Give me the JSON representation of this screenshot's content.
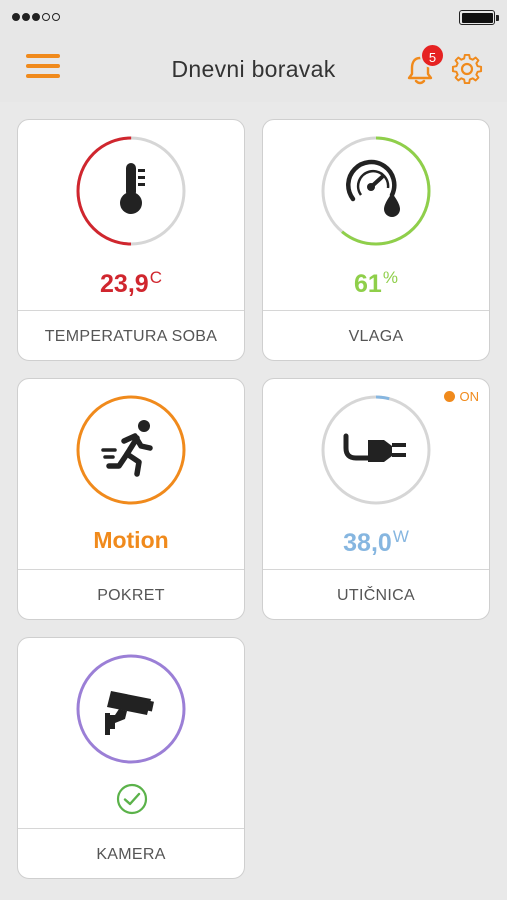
{
  "status_bar": {
    "signal_bars_filled": 3,
    "signal_bars_total": 5
  },
  "header": {
    "title": "Dnevni boravak",
    "notifications_count": "5",
    "accent_color": "#f08a1c",
    "badge_color": "#e62222"
  },
  "cards": [
    {
      "label": "TEMPERATURA SOBA",
      "value": "23,9",
      "unit": "C",
      "icon": "thermometer-icon",
      "color": "#d0262e",
      "ring_fraction": 0.5
    },
    {
      "label": "VLAGA",
      "value": "61",
      "unit": "%",
      "icon": "humidity-gauge-icon",
      "color": "#8fcf4a",
      "ring_fraction": 0.61
    },
    {
      "label": "POKRET",
      "value": "Motion",
      "unit": "",
      "icon": "running-person-icon",
      "color": "#f08a1c",
      "ring_fraction": 1
    },
    {
      "label": "UTIČNICA",
      "value": "38,0",
      "unit": "W",
      "icon": "power-plug-icon",
      "color": "#86b6e0",
      "ring_fraction": 0.04,
      "status_text": "ON",
      "status_color": "#f08a1c"
    },
    {
      "label": "KAMERA",
      "value": "",
      "unit": "",
      "icon": "security-camera-icon",
      "color": "#9b7fd6",
      "ring_fraction": 1,
      "status_icon": "check-circle-icon",
      "status_icon_color": "#5bb24a"
    }
  ]
}
